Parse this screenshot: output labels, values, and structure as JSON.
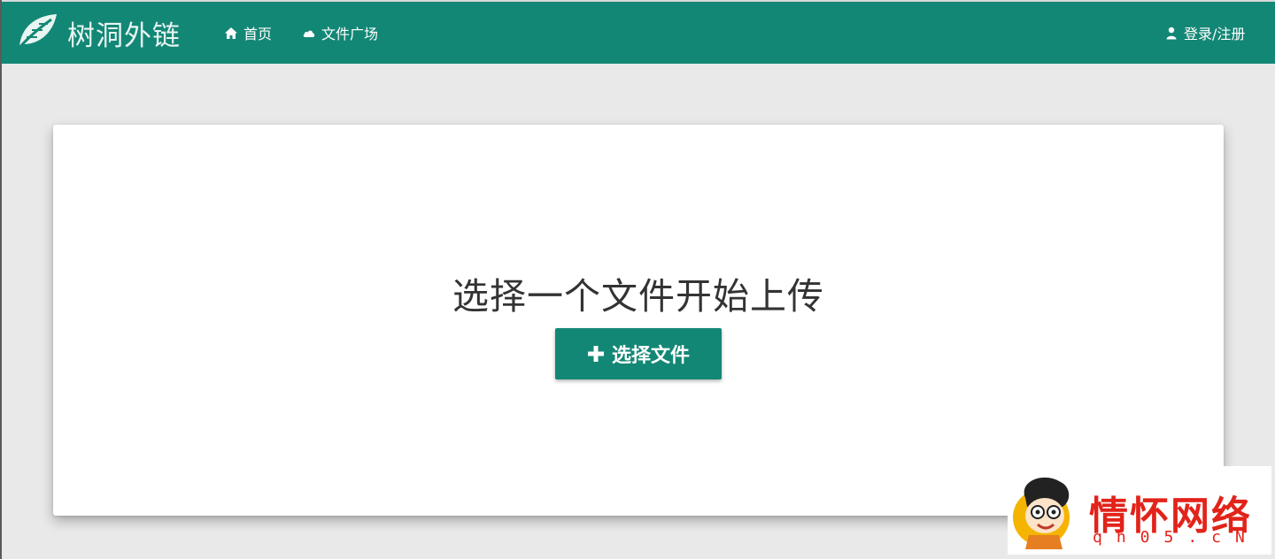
{
  "navbar": {
    "brand": "树洞外链",
    "links": [
      {
        "label": "首页",
        "icon": "home-icon"
      },
      {
        "label": "文件广场",
        "icon": "cloud-icon"
      }
    ],
    "login": {
      "label": "登录/注册",
      "icon": "user-icon"
    },
    "color": "#138775"
  },
  "upload": {
    "title": "选择一个文件开始上传",
    "button_label": "选择文件",
    "button_icon": "plus-icon"
  },
  "watermark": {
    "text": "情怀网络",
    "url": "qh05.cN"
  }
}
